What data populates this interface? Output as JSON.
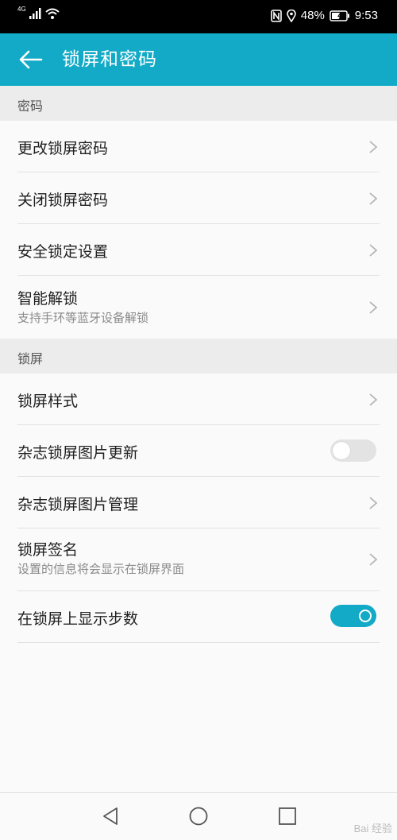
{
  "status_bar": {
    "network_type": "4G",
    "battery": "48%",
    "time": "9:53",
    "icons": [
      "signal-icon",
      "wifi-icon",
      "nfc-icon",
      "location-icon",
      "battery-icon"
    ]
  },
  "app_bar": {
    "title": "锁屏和密码",
    "background": "#12aac6"
  },
  "sections": [
    {
      "header": "密码",
      "items": [
        {
          "title": "更改锁屏密码",
          "control": "chevron"
        },
        {
          "title": "关闭锁屏密码",
          "control": "chevron"
        },
        {
          "title": "安全锁定设置",
          "control": "chevron"
        },
        {
          "title": "智能解锁",
          "subtitle": "支持手环等蓝牙设备解锁",
          "control": "chevron"
        }
      ]
    },
    {
      "header": "锁屏",
      "items": [
        {
          "title": "锁屏样式",
          "control": "chevron"
        },
        {
          "title": "杂志锁屏图片更新",
          "control": "toggle",
          "on": false
        },
        {
          "title": "杂志锁屏图片管理",
          "control": "chevron"
        },
        {
          "title": "锁屏签名",
          "subtitle": "设置的信息将会显示在锁屏界面",
          "control": "chevron"
        },
        {
          "title": "在锁屏上显示步数",
          "control": "toggle",
          "on": true
        }
      ]
    }
  ],
  "watermark": "Bai 经验"
}
